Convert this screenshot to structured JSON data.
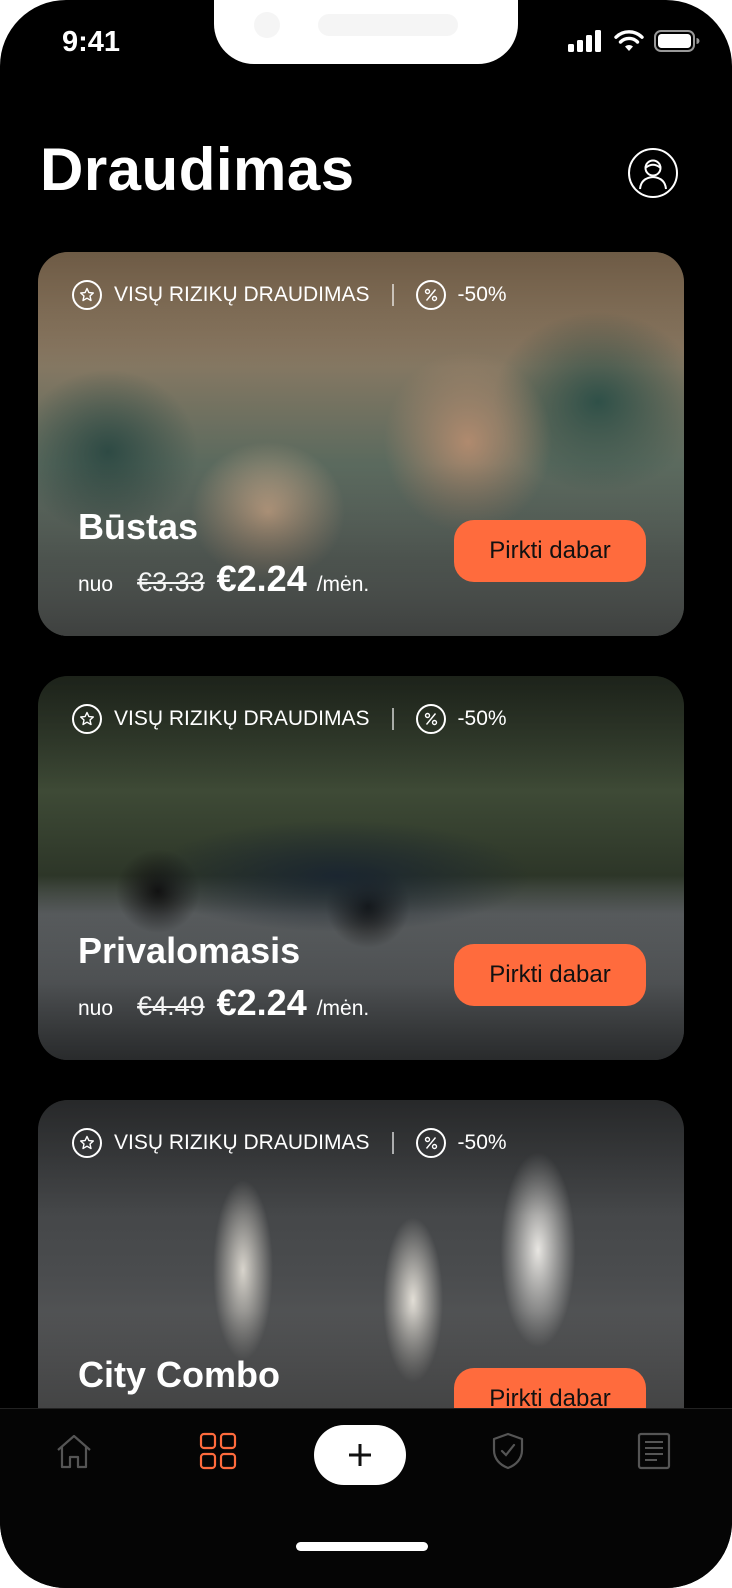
{
  "status": {
    "time": "9:41"
  },
  "header": {
    "title": "Draudimas",
    "profile_icon": "user-icon"
  },
  "cards": [
    {
      "badge": "VISŲ RIZIKŲ DRAUDIMAS",
      "discount": "-50%",
      "name": "Būstas",
      "nuo": "nuo",
      "old_price": "€3.33",
      "price": "€2.24",
      "per": "/mėn.",
      "button": "Pirkti dabar"
    },
    {
      "badge": "VISŲ RIZIKŲ DRAUDIMAS",
      "discount": "-50%",
      "name": "Privalomasis",
      "nuo": "nuo",
      "old_price": "€4.49",
      "price": "€2.24",
      "per": "/mėn.",
      "button": "Pirkti dabar"
    },
    {
      "badge": "VISŲ RIZIKŲ DRAUDIMAS",
      "discount": "-50%",
      "name": "City Combo",
      "button": "Pirkti dabar"
    }
  ],
  "tabbar": {
    "items": [
      "home-icon",
      "grid-icon",
      "plus-icon",
      "shield-icon",
      "document-icon"
    ],
    "active_color": "#ff6b3d"
  },
  "colors": {
    "accent": "#ff6b3d",
    "background": "#000000"
  }
}
